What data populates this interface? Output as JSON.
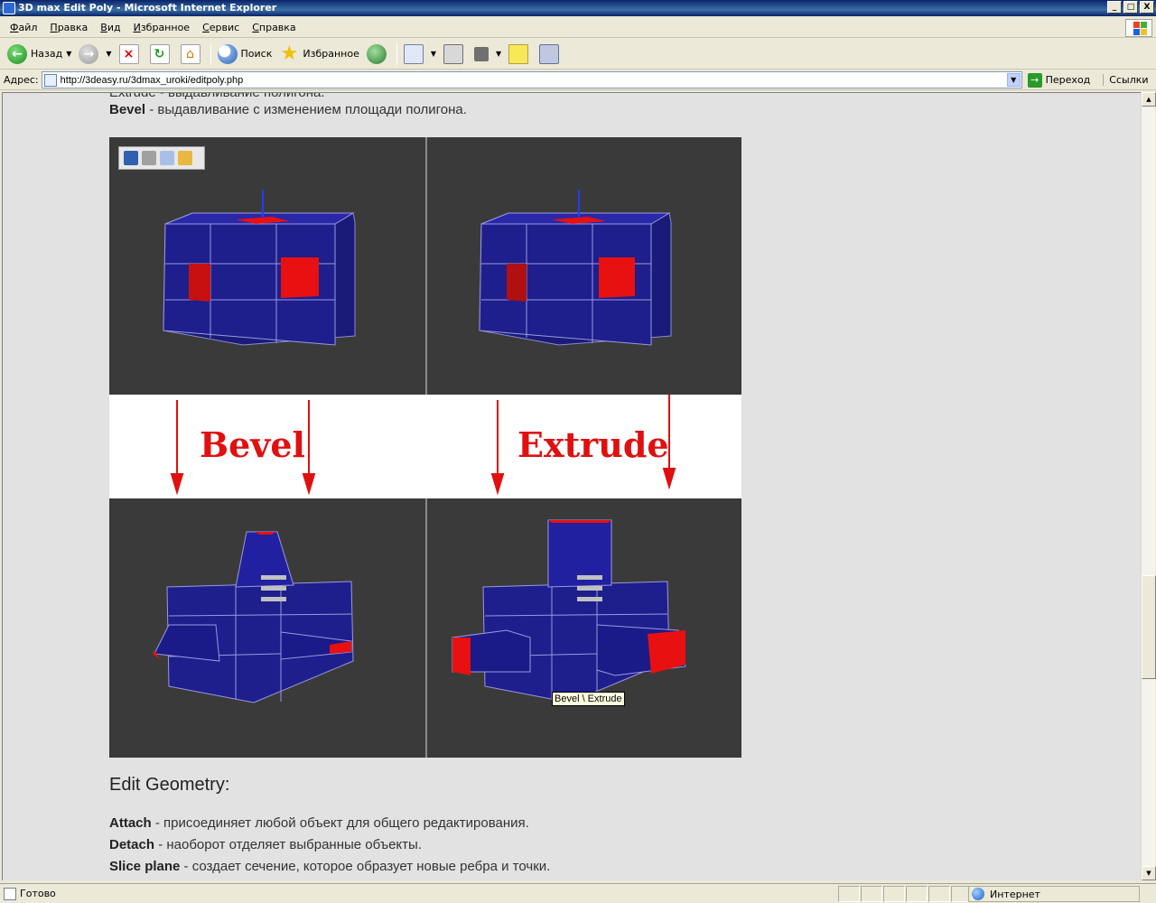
{
  "window": {
    "title": "3D max Edit Poly - Microsoft Internet Explorer",
    "controls": {
      "minimize": "_",
      "maximize": "□",
      "close": "X"
    }
  },
  "menu": [
    "Файл",
    "Правка",
    "Вид",
    "Избранное",
    "Сервис",
    "Справка"
  ],
  "toolbar": {
    "back_label": "Назад",
    "search_label": "Поиск",
    "favorites_label": "Избранное"
  },
  "address": {
    "label": "Адрес:",
    "url": "http://3deasy.ru/3dmax_uroki/editpoly.php",
    "go_label": "Переход",
    "links_label": "Ссылки"
  },
  "content": {
    "clipped_text": "Extrude - выдавливание полигона.",
    "bevel": {
      "term": "Bevel",
      "desc": " - выдавливание с изменением площади полигона."
    },
    "figure": {
      "label_left": "Bevel",
      "label_right": "Extrude",
      "tooltip": "Bevel \\ Extrude",
      "colors": {
        "mesh": "#1e1e8c",
        "selected": "#e81010",
        "viewport": "#3a3a3a",
        "arrows": "#e01010"
      }
    },
    "section_heading": "Edit Geometry:",
    "definitions": [
      {
        "term": "Attach",
        "desc": " - присоединяет любой объект для общего редактирования."
      },
      {
        "term": "Detach",
        "desc": " - наоборот отделяет выбранные объекты."
      },
      {
        "term": "Slice plane",
        "desc": " - создает сечение, которое образует новые ребра и точки."
      }
    ]
  },
  "status": {
    "text": "Готово",
    "zone": "Интернет"
  }
}
